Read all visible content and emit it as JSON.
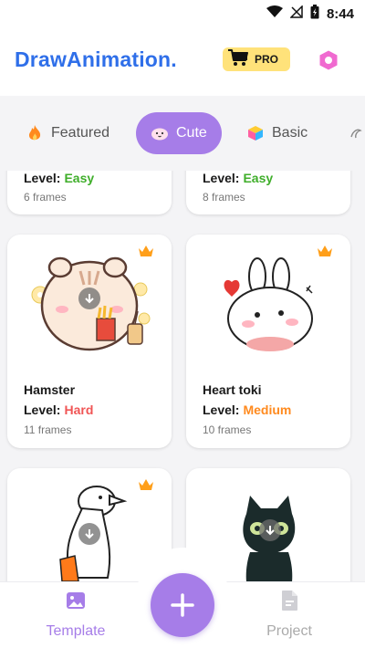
{
  "status_bar": {
    "time": "8:44"
  },
  "header": {
    "title": "DrawAnimation.",
    "pro_label": "PRO"
  },
  "tabs": [
    {
      "label": "Featured",
      "icon": "flame-icon",
      "active": false
    },
    {
      "label": "Cute",
      "icon": "cute-face-icon",
      "active": true
    },
    {
      "label": "Basic",
      "icon": "cube-icon",
      "active": false
    },
    {
      "label": "",
      "icon": "sketch-icon",
      "active": false
    }
  ],
  "level_prefix": "Level:",
  "cards": [
    {
      "name": "",
      "level": "Easy",
      "level_color": "#3fae2a",
      "frames": "6 frames",
      "premium": false
    },
    {
      "name": "",
      "level": "Easy",
      "level_color": "#3fae2a",
      "frames": "8 frames",
      "premium": false
    },
    {
      "name": "Hamster",
      "level": "Hard",
      "level_color": "#f05555",
      "frames": "11 frames",
      "premium": true
    },
    {
      "name": "Heart toki",
      "level": "Medium",
      "level_color": "#ff8a1e",
      "frames": "10 frames",
      "premium": true
    },
    {
      "name": "",
      "level": "",
      "frames": "",
      "premium": true
    },
    {
      "name": "",
      "level": "",
      "frames": "",
      "premium": false
    }
  ],
  "bottom_nav": {
    "template_label": "Template",
    "project_label": "Project",
    "active_color": "#a67de8",
    "inactive_color": "#aaaaaa"
  },
  "colors": {
    "accent": "#a67de8",
    "title_blue": "#2f6fe9",
    "pro_yellow": "#ffe27a",
    "crown": "#ff9f1a"
  }
}
